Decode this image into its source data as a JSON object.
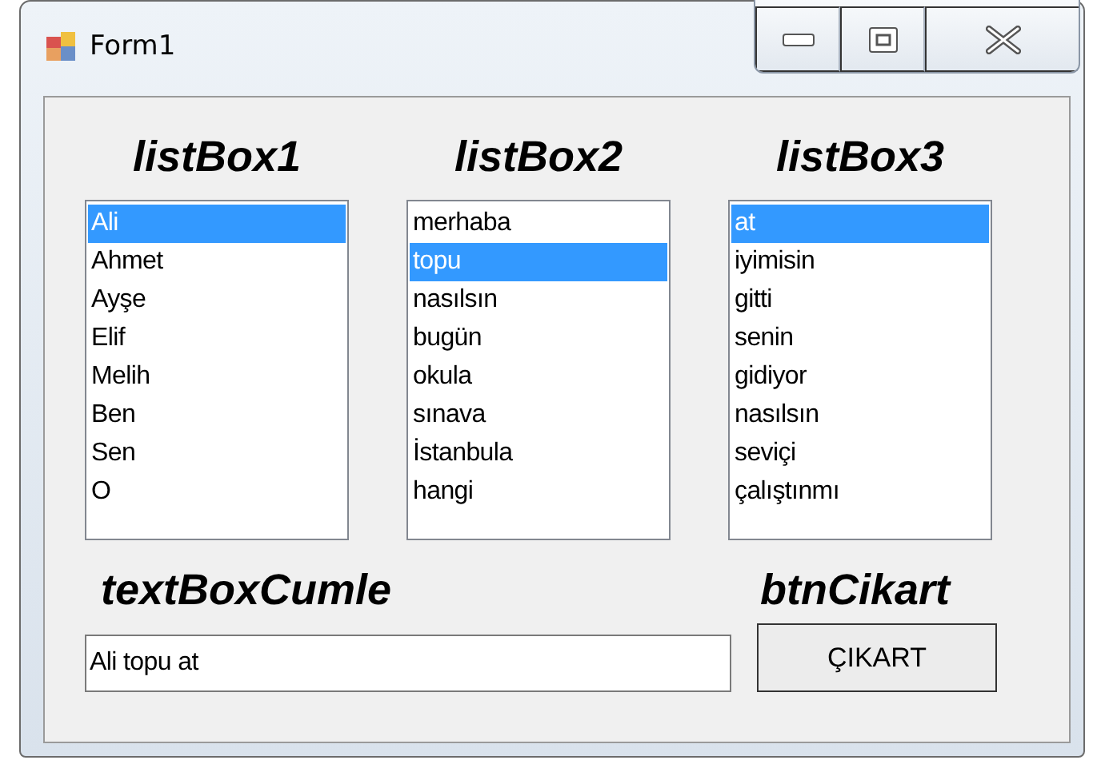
{
  "window": {
    "title": "Form1"
  },
  "list_boxes": [
    {
      "label": "listBox1",
      "items": [
        {
          "text": "Ali",
          "selected": true
        },
        {
          "text": "Ahmet",
          "selected": false
        },
        {
          "text": "Ayşe",
          "selected": false
        },
        {
          "text": "Elif",
          "selected": false
        },
        {
          "text": "Melih",
          "selected": false
        },
        {
          "text": "Ben",
          "selected": false
        },
        {
          "text": "Sen",
          "selected": false
        },
        {
          "text": "O",
          "selected": false
        }
      ]
    },
    {
      "label": "listBox2",
      "items": [
        {
          "text": "merhaba",
          "selected": false
        },
        {
          "text": "topu",
          "selected": true
        },
        {
          "text": "nasılsın",
          "selected": false
        },
        {
          "text": "bugün",
          "selected": false
        },
        {
          "text": "okula",
          "selected": false
        },
        {
          "text": "sınava",
          "selected": false
        },
        {
          "text": "İstanbula",
          "selected": false
        },
        {
          "text": "hangi",
          "selected": false
        }
      ]
    },
    {
      "label": "listBox3",
      "items": [
        {
          "text": "at",
          "selected": true
        },
        {
          "text": "iyimisin",
          "selected": false
        },
        {
          "text": "gitti",
          "selected": false
        },
        {
          "text": "senin",
          "selected": false
        },
        {
          "text": "gidiyor",
          "selected": false
        },
        {
          "text": "nasılsın",
          "selected": false
        },
        {
          "text": "seviçi",
          "selected": false
        },
        {
          "text": "çalıştınmı",
          "selected": false
        }
      ]
    }
  ],
  "sentence": {
    "label": "textBoxCumle",
    "value": "Ali topu at"
  },
  "button": {
    "label": "btnCikart",
    "text": "ÇIKART"
  }
}
